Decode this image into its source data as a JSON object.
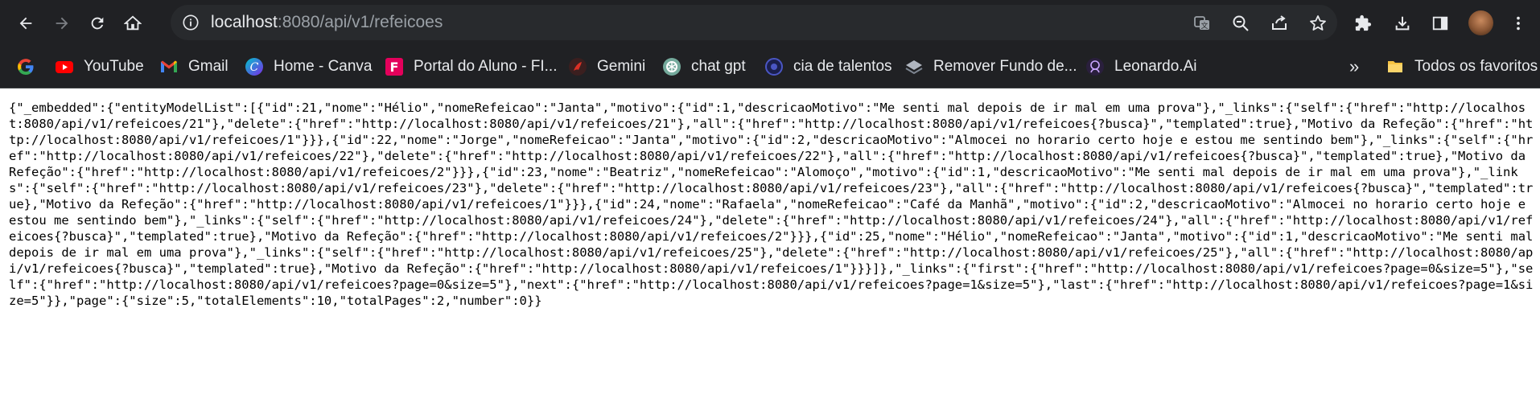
{
  "browser": {
    "url_host": "localhost",
    "url_path": ":8080/api/v1/refeicoes"
  },
  "bookmarks": [
    {
      "label": "",
      "icon": "google-icon"
    },
    {
      "label": "YouTube",
      "icon": "youtube-icon"
    },
    {
      "label": "Gmail",
      "icon": "gmail-icon"
    },
    {
      "label": "Home - Canva",
      "icon": "canva-icon"
    },
    {
      "label": "Portal do Aluno - FI...",
      "icon": "portal-icon"
    },
    {
      "label": "Gemini",
      "icon": "gemini-icon"
    },
    {
      "label": "chat gpt",
      "icon": "openai-icon"
    },
    {
      "label": "cia de talentos",
      "icon": "cia-icon"
    },
    {
      "label": "Remover Fundo de...",
      "icon": "remover-fundo-icon"
    },
    {
      "label": "Leonardo.Ai",
      "icon": "leonardo-icon"
    }
  ],
  "bookmarks_more": "»",
  "all_bookmarks_label": "Todos os favoritos",
  "colors": {
    "toolbar": "#202124",
    "omnibox": "#282a2d",
    "text_light": "#e8eaed",
    "text_dim": "#9aa0a6"
  },
  "json_text": "{\"_embedded\":{\"entityModelList\":[{\"id\":21,\"nome\":\"Hélio\",\"nomeRefeicao\":\"Janta\",\"motivo\":{\"id\":1,\"descricaoMotivo\":\"Me senti mal depois de ir mal em uma prova\"},\"_links\":{\"self\":{\"href\":\"http://localhost:8080/api/v1/refeicoes/21\"},\"delete\":{\"href\":\"http://localhost:8080/api/v1/refeicoes/21\"},\"all\":{\"href\":\"http://localhost:8080/api/v1/refeicoes{?busca}\",\"templated\":true},\"Motivo da Refeção\":{\"href\":\"http://localhost:8080/api/v1/refeicoes/1\"}}},{\"id\":22,\"nome\":\"Jorge\",\"nomeRefeicao\":\"Janta\",\"motivo\":{\"id\":2,\"descricaoMotivo\":\"Almocei no horario certo hoje e estou me sentindo bem\"},\"_links\":{\"self\":{\"href\":\"http://localhost:8080/api/v1/refeicoes/22\"},\"delete\":{\"href\":\"http://localhost:8080/api/v1/refeicoes/22\"},\"all\":{\"href\":\"http://localhost:8080/api/v1/refeicoes{?busca}\",\"templated\":true},\"Motivo da Refeção\":{\"href\":\"http://localhost:8080/api/v1/refeicoes/2\"}}},{\"id\":23,\"nome\":\"Beatriz\",\"nomeRefeicao\":\"Alomoço\",\"motivo\":{\"id\":1,\"descricaoMotivo\":\"Me senti mal depois de ir mal em uma prova\"},\"_links\":{\"self\":{\"href\":\"http://localhost:8080/api/v1/refeicoes/23\"},\"delete\":{\"href\":\"http://localhost:8080/api/v1/refeicoes/23\"},\"all\":{\"href\":\"http://localhost:8080/api/v1/refeicoes{?busca}\",\"templated\":true},\"Motivo da Refeção\":{\"href\":\"http://localhost:8080/api/v1/refeicoes/1\"}}},{\"id\":24,\"nome\":\"Rafaela\",\"nomeRefeicao\":\"Café da Manhã\",\"motivo\":{\"id\":2,\"descricaoMotivo\":\"Almocei no horario certo hoje e estou me sentindo bem\"},\"_links\":{\"self\":{\"href\":\"http://localhost:8080/api/v1/refeicoes/24\"},\"delete\":{\"href\":\"http://localhost:8080/api/v1/refeicoes/24\"},\"all\":{\"href\":\"http://localhost:8080/api/v1/refeicoes{?busca}\",\"templated\":true},\"Motivo da Refeção\":{\"href\":\"http://localhost:8080/api/v1/refeicoes/2\"}}},{\"id\":25,\"nome\":\"Hélio\",\"nomeRefeicao\":\"Janta\",\"motivo\":{\"id\":1,\"descricaoMotivo\":\"Me senti mal depois de ir mal em uma prova\"},\"_links\":{\"self\":{\"href\":\"http://localhost:8080/api/v1/refeicoes/25\"},\"delete\":{\"href\":\"http://localhost:8080/api/v1/refeicoes/25\"},\"all\":{\"href\":\"http://localhost:8080/api/v1/refeicoes{?busca}\",\"templated\":true},\"Motivo da Refeção\":{\"href\":\"http://localhost:8080/api/v1/refeicoes/1\"}}}]},\"_links\":{\"first\":{\"href\":\"http://localhost:8080/api/v1/refeicoes?page=0&size=5\"},\"self\":{\"href\":\"http://localhost:8080/api/v1/refeicoes?page=0&size=5\"},\"next\":{\"href\":\"http://localhost:8080/api/v1/refeicoes?page=1&size=5\"},\"last\":{\"href\":\"http://localhost:8080/api/v1/refeicoes?page=1&size=5\"}},\"page\":{\"size\":5,\"totalElements\":10,\"totalPages\":2,\"number\":0}}"
}
